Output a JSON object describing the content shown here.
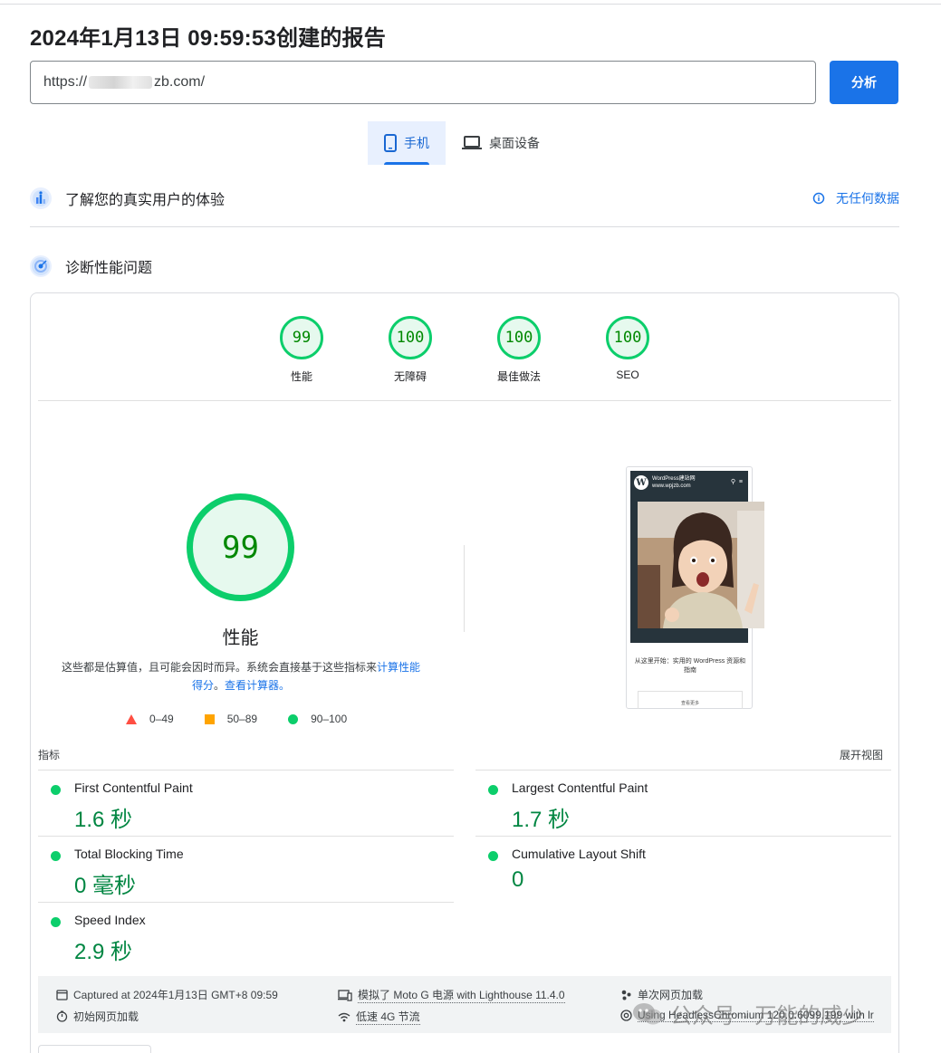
{
  "report_title": "2024年1月13日 09:59:53创建的报告",
  "url": {
    "prefix": "https://",
    "suffix": "zb.com/"
  },
  "analyze_button": "分析",
  "device_tabs": [
    {
      "label": "手机",
      "icon": "phone-icon",
      "active": true
    },
    {
      "label": "桌面设备",
      "icon": "laptop-icon",
      "active": false
    }
  ],
  "crux_section": {
    "label": "了解您的真实用户的体验",
    "no_data": "无任何数据"
  },
  "diagnose_section": {
    "label": "诊断性能问题"
  },
  "category_scores": [
    {
      "score": "99",
      "label": "性能"
    },
    {
      "score": "100",
      "label": "无障碍"
    },
    {
      "score": "100",
      "label": "最佳做法"
    },
    {
      "score": "100",
      "label": "SEO"
    }
  ],
  "performance": {
    "score": "99",
    "label": "性能",
    "desc_text": "这些都是估算值，且可能会因时而异。系统会直接基于这些指标来",
    "desc_link1": "计算性能得分",
    "desc_sep": "。",
    "desc_link2": "查看计算器。"
  },
  "legend": [
    {
      "range": "0–49",
      "shape": "triangle",
      "color": "#ff4e42"
    },
    {
      "range": "50–89",
      "shape": "square",
      "color": "#ffa400"
    },
    {
      "range": "90–100",
      "shape": "circle",
      "color": "#0cce6b"
    }
  ],
  "screenshot": {
    "site_name": "WordPress建站网",
    "site_url": "www.wpjzb.com",
    "tagline": "从这里开始：实用的 WordPress 资源和指南",
    "button": "查看更多"
  },
  "metrics_header": {
    "title": "指标",
    "expand": "展开视图"
  },
  "metrics": [
    {
      "name": "First Contentful Paint",
      "value": "1.6 秒"
    },
    {
      "name": "Largest Contentful Paint",
      "value": "1.7 秒"
    },
    {
      "name": "Total Blocking Time",
      "value": "0 毫秒"
    },
    {
      "name": "Cumulative Layout Shift",
      "value": "0"
    },
    {
      "name": "Speed Index",
      "value": "2.9 秒"
    }
  ],
  "footer": {
    "captured": "Captured at 2024年1月13日 GMT+8 09:59",
    "initial_load": "初始网页加载",
    "emulated": "模拟了 Moto G 电源 with Lighthouse 11.4.0",
    "throttling": "低速 4G 节流",
    "single_load": "单次网页加载",
    "browser": "Using HeadlessChromium 120.0.6099.199 with lr"
  },
  "watermark": "公众号 · 万能的威少",
  "colors": {
    "accent": "#1a73e8",
    "pass": "#0cce6b",
    "pass_text": "#018642"
  }
}
